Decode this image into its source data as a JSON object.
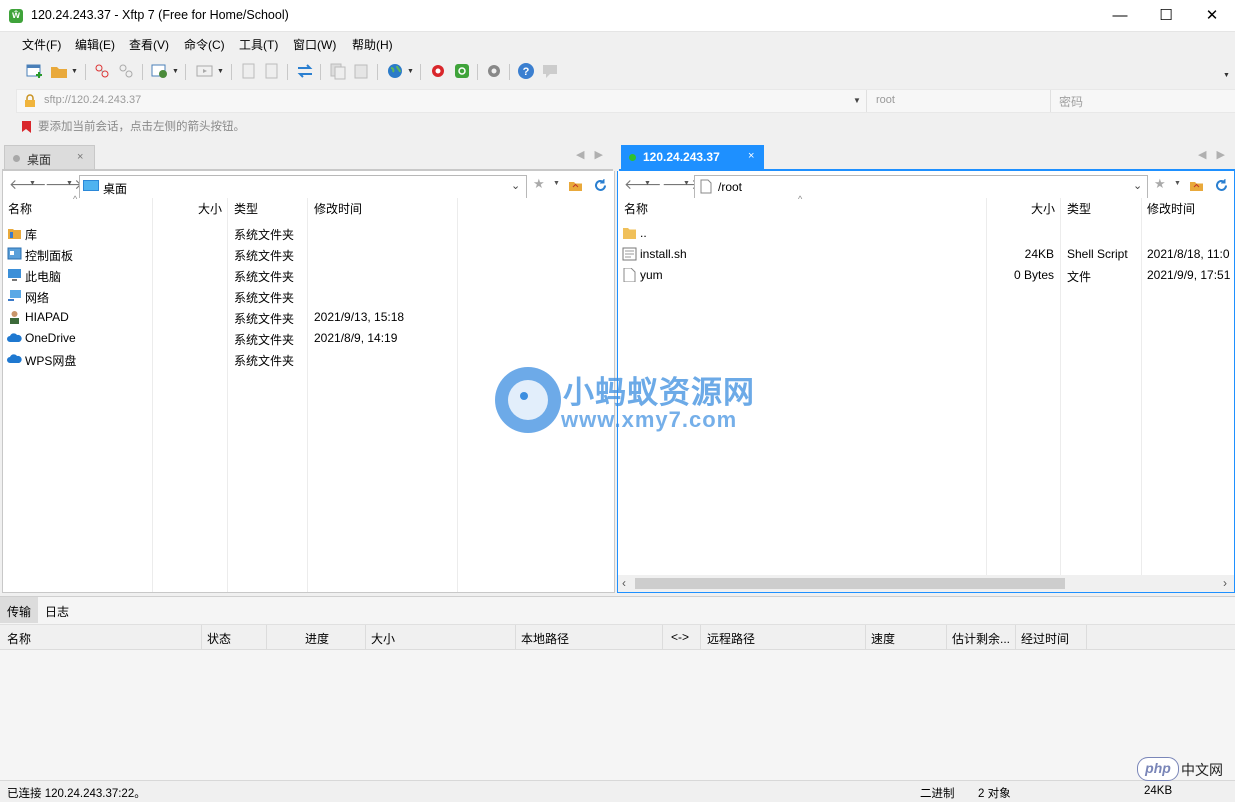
{
  "window": {
    "title": "120.24.243.37 - Xftp 7 (Free for Home/School)",
    "app_icon_letter": "ŵ",
    "minimize": "—",
    "maximize": "☐",
    "close": "✕"
  },
  "menu": [
    "文件(F)",
    "编辑(E)",
    "查看(V)",
    "命令(C)",
    "工具(T)",
    "窗口(W)",
    "帮助(H)"
  ],
  "address": {
    "url": "sftp://120.24.243.37",
    "user": "root",
    "password_placeholder": "密码"
  },
  "hint": "要添加当前会话，点击左侧的箭头按钮。",
  "left_tab": {
    "label": "桌面",
    "close": "×"
  },
  "right_tab": {
    "label": "120.24.243.37",
    "close": "×"
  },
  "left_pane": {
    "path": "桌面",
    "columns": [
      "名称",
      "大小",
      "类型",
      "修改时间"
    ],
    "rows": [
      {
        "name": "库",
        "size": "",
        "type": "系统文件夹",
        "modified": "",
        "icon": "library-icon"
      },
      {
        "name": "控制面板",
        "size": "",
        "type": "系统文件夹",
        "modified": "",
        "icon": "control-panel-icon"
      },
      {
        "name": "此电脑",
        "size": "",
        "type": "系统文件夹",
        "modified": "",
        "icon": "computer-icon"
      },
      {
        "name": "网络",
        "size": "",
        "type": "系统文件夹",
        "modified": "",
        "icon": "network-icon"
      },
      {
        "name": "HIAPAD",
        "size": "",
        "type": "系统文件夹",
        "modified": "2021/9/13, 15:18",
        "icon": "user-icon"
      },
      {
        "name": "OneDrive",
        "size": "",
        "type": "系统文件夹",
        "modified": "2021/8/9, 14:19",
        "icon": "cloud-icon"
      },
      {
        "name": "WPS网盘",
        "size": "",
        "type": "系统文件夹",
        "modified": "",
        "icon": "cloud-icon"
      }
    ]
  },
  "right_pane": {
    "path": "/root",
    "columns": [
      "名称",
      "大小",
      "类型",
      "修改时间"
    ],
    "rows": [
      {
        "name": "..",
        "size": "",
        "type": "",
        "modified": "",
        "icon": "folder-icon"
      },
      {
        "name": "install.sh",
        "size": "24KB",
        "type": "Shell Script",
        "modified": "2021/8/18, 11:0",
        "icon": "script-file-icon"
      },
      {
        "name": "yum",
        "size": "0 Bytes",
        "type": "文件",
        "modified": "2021/9/9, 17:51",
        "icon": "file-icon"
      }
    ]
  },
  "watermark": {
    "title": "小蚂蚁资源网",
    "url": "www.xmy7.com"
  },
  "bottom_tabs": [
    "传输",
    "日志"
  ],
  "transfer_columns": [
    "名称",
    "状态",
    "进度",
    "大小",
    "本地路径",
    "<->",
    "远程路径",
    "速度",
    "估计剩余...",
    "经过时间"
  ],
  "status": {
    "connection": "已连接 120.24.243.37:22。",
    "mode": "二进制",
    "objects": "2 对象",
    "size": "24KB",
    "php_badge": "php",
    "cn_label": "中文网"
  },
  "colors": {
    "accent": "#1e90ff",
    "tab_active": "#1e90ff",
    "green_dot": "#2fc12f"
  }
}
